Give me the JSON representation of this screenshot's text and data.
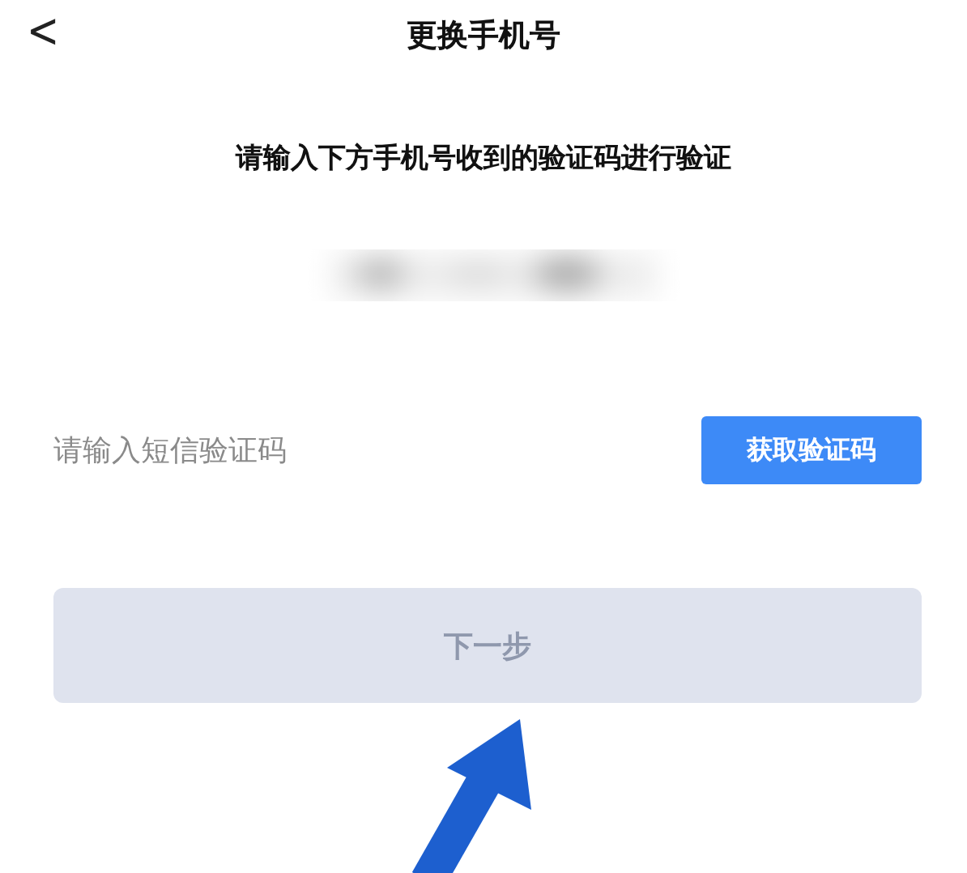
{
  "header": {
    "back_icon": "<",
    "title": "更换手机号"
  },
  "instruction": "请输入下方手机号收到的验证码进行验证",
  "phone": {
    "kind": "blurred"
  },
  "code_field": {
    "placeholder": "请输入短信验证码"
  },
  "get_code_button": {
    "label": "获取验证码",
    "disabled": false
  },
  "next_button": {
    "label": "下一步",
    "disabled": true
  }
}
